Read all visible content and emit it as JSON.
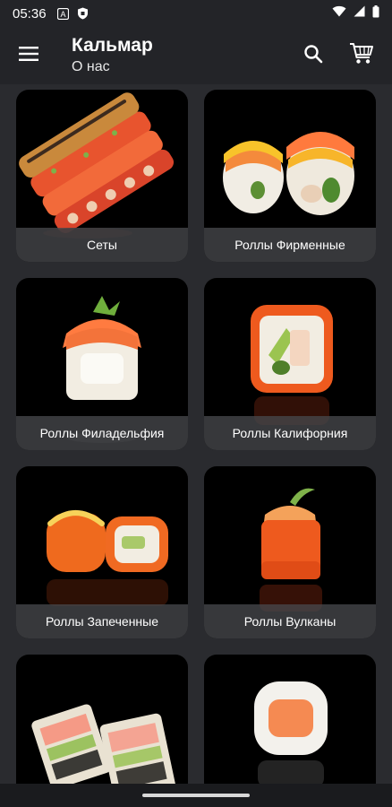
{
  "status_bar": {
    "time": "05:36"
  },
  "app_bar": {
    "title": "Кальмар",
    "subtitle": "О нас"
  },
  "icons": {
    "menu": "menu-icon",
    "search": "search-icon",
    "cart": "cart-icon"
  },
  "categories": [
    {
      "label": "Сеты"
    },
    {
      "label": "Роллы Фирменные"
    },
    {
      "label": "Роллы Филадельфия"
    },
    {
      "label": "Роллы Калифорния"
    },
    {
      "label": "Роллы Запеченные"
    },
    {
      "label": "Роллы Вулканы"
    },
    {
      "label": ""
    },
    {
      "label": ""
    }
  ],
  "colors": {
    "background": "#2a2b2f",
    "app_bar": "#232428",
    "card_background": "#000000",
    "label_band": "#46484c"
  }
}
